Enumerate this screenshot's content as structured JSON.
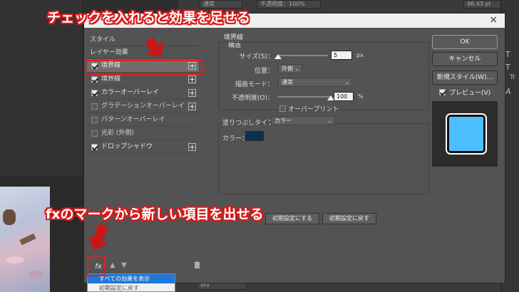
{
  "app": {
    "top_fields": [
      "通常",
      "不透明度：100%",
      "96.43 pt"
    ],
    "bottom_field": "W9",
    "right_glyphs": [
      "T",
      "T",
      "Tr",
      "A"
    ]
  },
  "dialog": {
    "close_label": "×",
    "left_list": {
      "headers": [
        "スタイル",
        "レイヤー効果"
      ],
      "items": [
        {
          "label": "境界線",
          "checked": true,
          "plus": true,
          "selected": true
        },
        {
          "label": "境界線",
          "checked": true,
          "plus": true,
          "selected": false
        },
        {
          "label": "カラーオーバーレイ",
          "checked": true,
          "plus": true,
          "selected": false
        },
        {
          "label": "グラデーションオーバーレイ",
          "checked": false,
          "plus": true,
          "selected": false
        },
        {
          "label": "パターンオーバーレイ",
          "checked": false,
          "plus": false,
          "selected": false
        },
        {
          "label": "光彩 (外側)",
          "checked": false,
          "plus": false,
          "selected": false
        },
        {
          "label": "ドロップシャドウ",
          "checked": true,
          "plus": true,
          "selected": false
        }
      ],
      "fx_label": "fx",
      "up_icon": "▲",
      "down_icon": "▼",
      "trash_icon": "🗑"
    },
    "context_menu": {
      "items": [
        "すべての効果を表示",
        "初期設定に戻す"
      ]
    },
    "stroke": {
      "section_title": "境界線",
      "structure_title": "構造",
      "size_label": "サイズ(S)：",
      "size_value": "5",
      "size_unit": "px",
      "size_level": 0.0,
      "position_label": "位置：",
      "position_value": "外側",
      "blend_label": "描画モード：",
      "blend_value": "通常",
      "opacity_label": "不透明度(O)：",
      "opacity_value": "100",
      "opacity_unit": "%",
      "opacity_level": 1.0,
      "overprint_label": "オーバープリント",
      "fill_type_label": "塗りつぶしタイプ：",
      "fill_type_value": "カラー",
      "color_label": "カラー：",
      "color_value": "#0c2f52",
      "btn_make_default": "初期設定にする",
      "btn_reset_default": "初期設定に戻す"
    },
    "right": {
      "ok_label": "OK",
      "cancel_label": "キャンセル",
      "new_style_label": "新規スタイル(W)...",
      "preview_label": "プレビュー(V)",
      "preview_fill": "#4cc0ff"
    }
  },
  "annotations": {
    "top_text": "チェックを入れると効果を足せる",
    "bottom_text": "fxのマークから新しい項目を出せる",
    "accent_color": "#d81b1b"
  }
}
